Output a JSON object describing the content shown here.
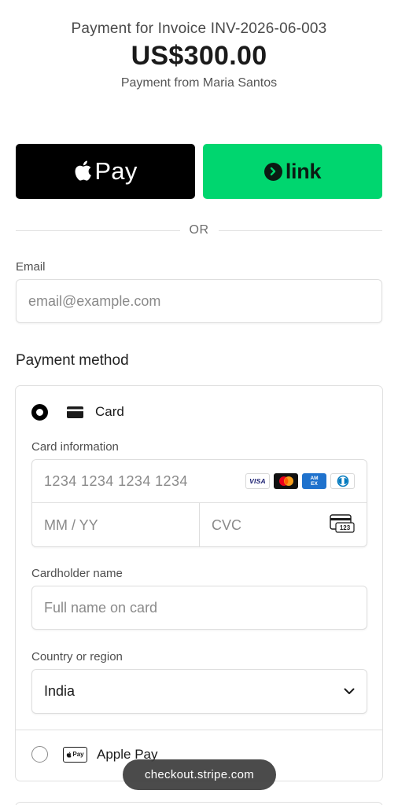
{
  "header": {
    "invoice_title": "Payment for Invoice INV-2026-06-003",
    "amount": "US$300.00",
    "from": "Payment from Maria Santos"
  },
  "wallets": {
    "apple_pay_label": "Pay",
    "link_label": "link"
  },
  "divider": {
    "or_label": "OR"
  },
  "email": {
    "label": "Email",
    "placeholder": "email@example.com"
  },
  "payment_method": {
    "heading": "Payment method",
    "card": {
      "label": "Card",
      "selected": true,
      "card_info_label": "Card information",
      "number_placeholder": "1234 1234 1234 1234",
      "expiry_placeholder": "MM / YY",
      "cvc_placeholder": "CVC",
      "cvc_icon_text": "123",
      "brands": [
        "visa",
        "mastercard",
        "amex",
        "diners"
      ],
      "brand_texts": {
        "visa": "VISA",
        "amex_top": "AM",
        "amex_bottom": "EX"
      },
      "cardholder_label": "Cardholder name",
      "cardholder_placeholder": "Full name on card",
      "country_label": "Country or region",
      "country_value": "India"
    },
    "apple_pay": {
      "label": "Apple Pay",
      "badge_text": "Pay",
      "selected": false
    }
  },
  "browser": {
    "url": "checkout.stripe.com"
  },
  "colors": {
    "link_green": "#00d66f",
    "apple_black": "#000000",
    "visa_blue": "#1a1f71",
    "amex_blue": "#1f72cd",
    "diners_blue": "#0079be"
  }
}
